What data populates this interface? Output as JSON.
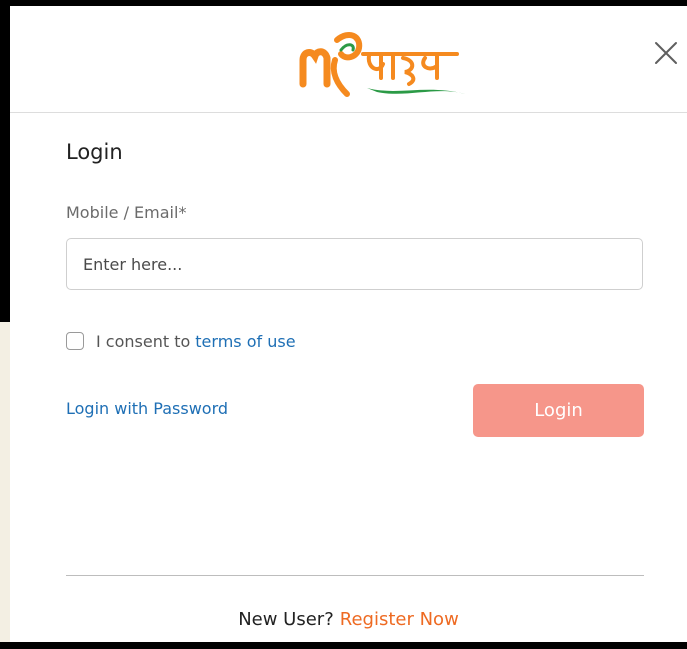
{
  "header": {
    "logo_icon": "my-bharat-logo",
    "close_icon": "close-icon"
  },
  "form": {
    "title": "Login",
    "field_label": "Mobile / Email*",
    "input_placeholder": "Enter here...",
    "input_value": "",
    "consent_text": "I consent to",
    "consent_link": "terms of use",
    "consent_checked": false,
    "password_link": "Login with Password",
    "login_button": "Login"
  },
  "footer": {
    "new_user_text": "New User?",
    "register_link": "Register Now"
  },
  "colors": {
    "primary_button": "#f6968a",
    "link_blue": "#1e6fb5",
    "register_orange": "#ee6a22",
    "logo_orange": "#f58a1f",
    "logo_green": "#2b9a46"
  }
}
